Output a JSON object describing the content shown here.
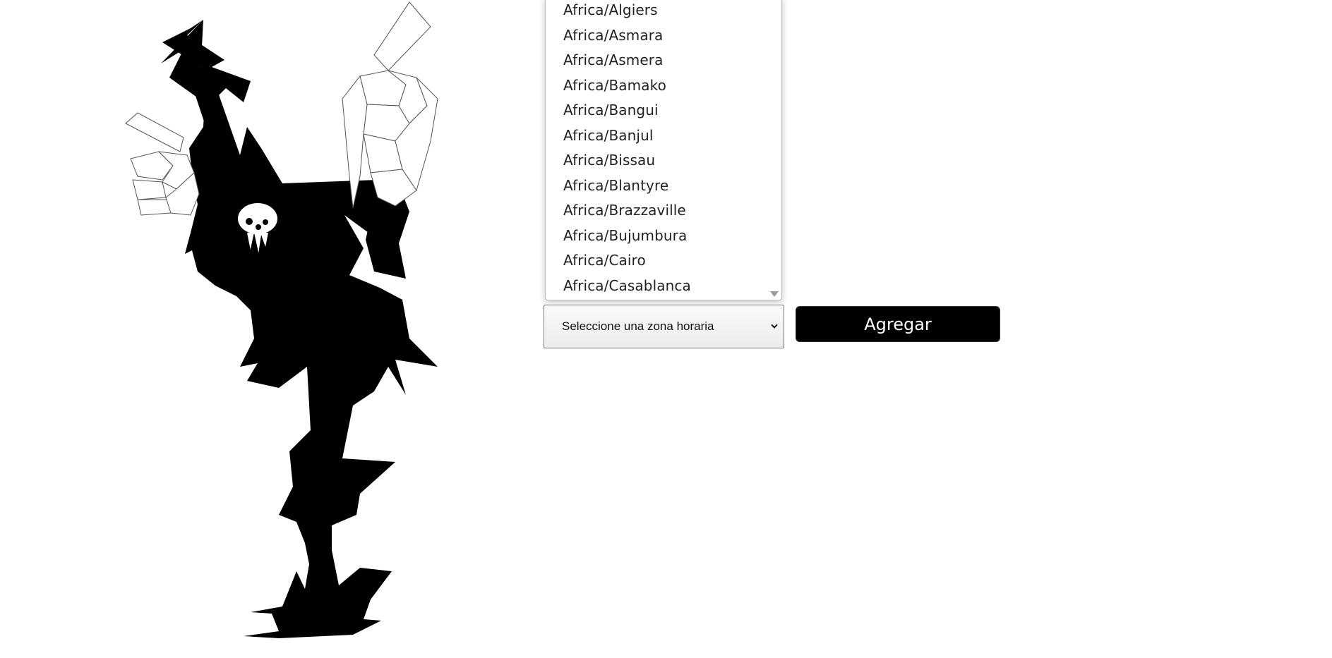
{
  "timezone_dropdown": {
    "options": [
      "Africa/Algiers",
      "Africa/Asmara",
      "Africa/Asmera",
      "Africa/Bamako",
      "Africa/Bangui",
      "Africa/Banjul",
      "Africa/Bissau",
      "Africa/Blantyre",
      "Africa/Brazzaville",
      "Africa/Bujumbura",
      "Africa/Cairo",
      "Africa/Casablanca"
    ],
    "scroll_icon": "triangle-down-icon"
  },
  "timezone_select": {
    "selected_label": "Seleccione una zona horaria",
    "icon": "chevron-down-icon"
  },
  "add_button": {
    "label": "Agregar"
  },
  "illustration": {
    "icon": "reaper-character-illustration"
  },
  "colors": {
    "button_bg": "#000000",
    "button_text": "#ffffff",
    "page_bg": "#ffffff"
  }
}
